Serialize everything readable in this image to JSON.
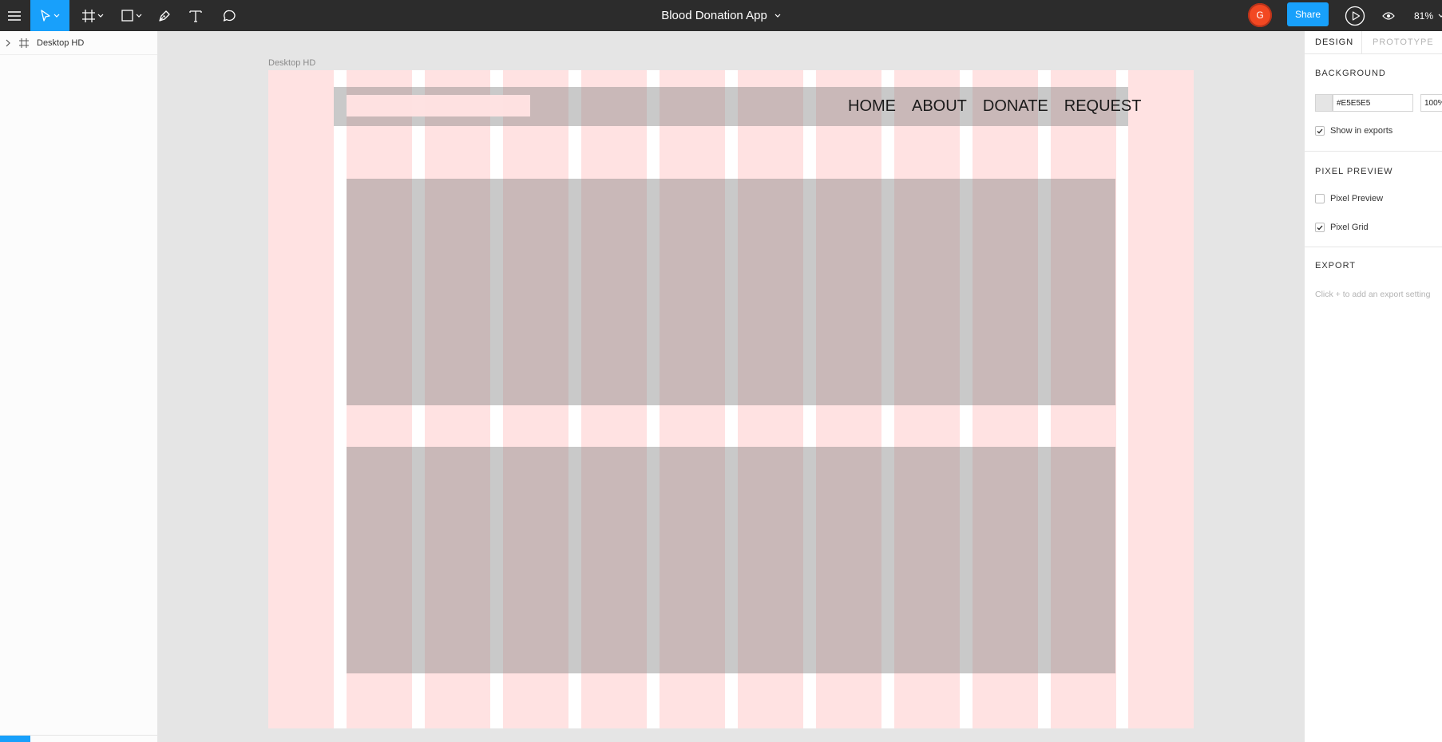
{
  "app": {
    "file_title": "Blood Donation App",
    "zoom": "81%",
    "share_label": "Share",
    "avatar_initial": "G"
  },
  "toolbar": {
    "tools": [
      "menu-icon",
      "move-tool-icon",
      "frame-tool-icon",
      "shape-tool-icon",
      "pen-tool-icon",
      "text-tool-icon",
      "comment-tool-icon"
    ]
  },
  "layers": {
    "items": [
      {
        "label": "Desktop HD"
      }
    ]
  },
  "canvas": {
    "frame_name": "Desktop HD",
    "nav_links": [
      "HOME",
      "ABOUT",
      "DONATE",
      "REQUEST"
    ],
    "grid_columns": 12
  },
  "inspector": {
    "tabs": [
      "DESIGN",
      "PROTOTYPE"
    ],
    "background": {
      "title": "BACKGROUND",
      "hex": "#E5E5E5",
      "opacity": "100%",
      "show_in_exports_label": "Show in exports",
      "show_in_exports": true
    },
    "pixel_preview": {
      "title": "PIXEL PREVIEW",
      "pixel_preview_label": "Pixel Preview",
      "pixel_preview": false,
      "pixel_grid_label": "Pixel Grid",
      "pixel_grid": true
    },
    "export": {
      "title": "EXPORT",
      "hint": "Click + to add an export setting"
    }
  },
  "colors": {
    "toolbar_bg": "#2c2c2c",
    "accent": "#18a0fb",
    "avatar": "#f24822",
    "canvas_bg": "#e5e5e5",
    "grid_column": "#ffe2e2",
    "placeholder_block": "#cab0b1"
  }
}
